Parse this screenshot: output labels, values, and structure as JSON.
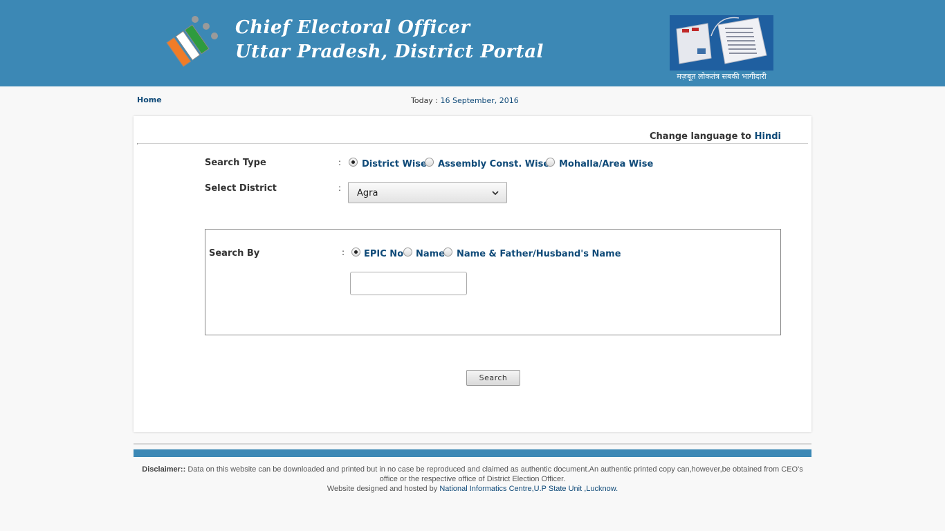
{
  "header": {
    "title_line1": "Chief Electoral Officer",
    "title_line2": "Uttar Pradesh, District Portal",
    "evm_caption": "मज़बूत लोकतंत्र सबकी भागीदारी",
    "logo_icon": "election-commission-logo-icon",
    "evm_icon": "evm-machine-icon",
    "colors": {
      "header_bg": "#3c88b5",
      "link": "#0f4a78"
    }
  },
  "nav": {
    "home": "Home",
    "today_label": "Today :",
    "today_date": "16 September, 2016"
  },
  "language": {
    "prefix": "Change language to",
    "link": "Hindi"
  },
  "form": {
    "search_type_label": "Search Type",
    "colon": ":",
    "search_type_options": [
      "District Wise",
      "Assembly Const. Wise",
      "Mohalla/Area Wise"
    ],
    "search_type_selected": "District Wise",
    "district_label": "Select District",
    "district_value": "Agra",
    "search_by_label": "Search By",
    "search_by_options": [
      "EPIC No",
      "Name",
      "Name & Father/Husband's Name"
    ],
    "search_by_selected": "EPIC No",
    "epic_input_value": "",
    "search_button": "Search"
  },
  "footer": {
    "disclaimer_label": "Disclaimer::",
    "disclaimer_text": "Data on this website can be downloaded and printed but in no case be reproduced and claimed as authentic document.An authentic printed copy can,however,be obtained from CEO's office or the respective office of District Election Officer.",
    "hosted_prefix": "Website designed and hosted by",
    "hosted_link": "National Informatics Centre,U.P State Unit ,Lucknow."
  }
}
